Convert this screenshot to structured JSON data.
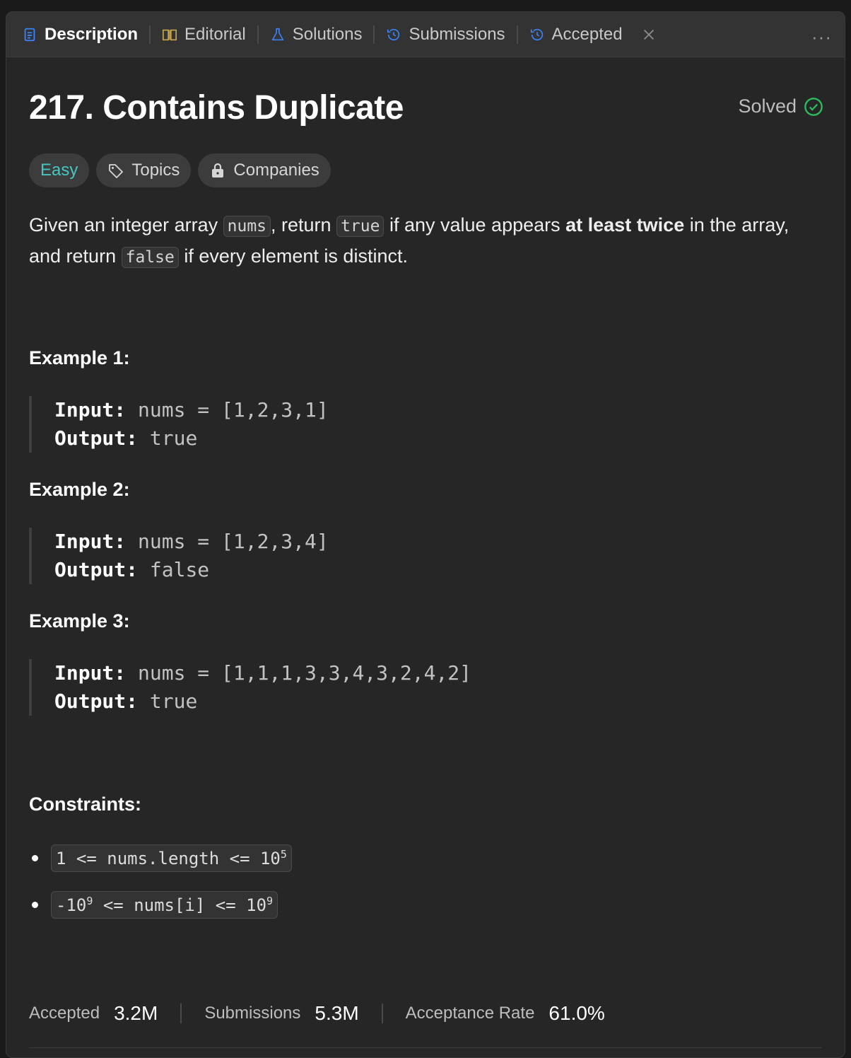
{
  "tabs": [
    {
      "label": "Description",
      "icon": "document-icon"
    },
    {
      "label": "Editorial",
      "icon": "book-icon"
    },
    {
      "label": "Solutions",
      "icon": "flask-icon"
    },
    {
      "label": "Submissions",
      "icon": "history-icon"
    },
    {
      "label": "Accepted",
      "icon": "history-icon"
    }
  ],
  "more_label": "···",
  "problem": {
    "title": "217. Contains Duplicate",
    "status": "Solved",
    "difficulty": "Easy",
    "topics_label": "Topics",
    "companies_label": "Companies"
  },
  "description": {
    "p1": "Given an integer array ",
    "c1": "nums",
    "p2": ", return ",
    "c2": "true",
    "p3": " if any value appears ",
    "bold": "at least twice",
    "p4": " in the array, and return ",
    "c3": "false",
    "p5": " if every element is distinct."
  },
  "examples": [
    {
      "title": "Example 1:",
      "input_label": "Input:",
      "input": "nums = [1,2,3,1]",
      "output_label": "Output:",
      "output": "true"
    },
    {
      "title": "Example 2:",
      "input_label": "Input:",
      "input": "nums = [1,2,3,4]",
      "output_label": "Output:",
      "output": "false"
    },
    {
      "title": "Example 3:",
      "input_label": "Input:",
      "input": "nums = [1,1,1,3,3,4,3,2,4,2]",
      "output_label": "Output:",
      "output": "true"
    }
  ],
  "constraints": {
    "title": "Constraints:",
    "c1": {
      "a": "1 <= nums.length <= 10",
      "exp": "5"
    },
    "c2": {
      "a": "-10",
      "exp1": "9",
      "b": " <= nums[i] <= 10",
      "exp2": "9"
    }
  },
  "stats": {
    "accepted_label": "Accepted",
    "accepted_value": "3.2M",
    "submissions_label": "Submissions",
    "submissions_value": "5.3M",
    "rate_label": "Acceptance Rate",
    "rate_value": "61.0%"
  },
  "colors": {
    "easy": "#46c6c2",
    "solved": "#2cbb5d",
    "accent_blue": "#3b82f6",
    "editorial": "#c8a44a"
  }
}
